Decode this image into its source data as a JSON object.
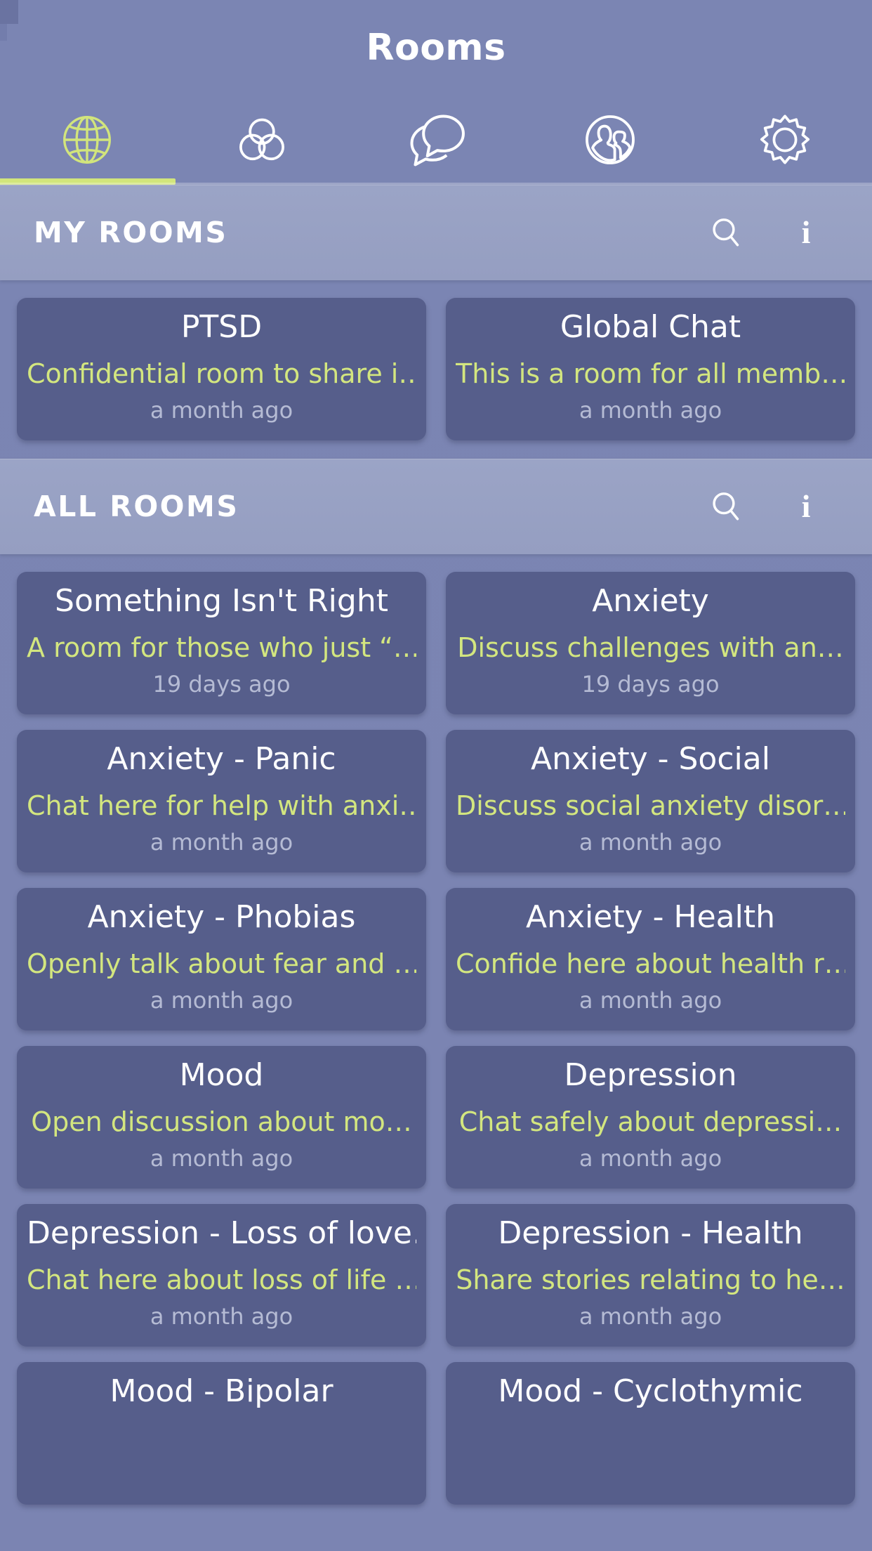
{
  "appbar": {
    "title": "Rooms"
  },
  "tabs": [
    {
      "label": "Global",
      "icon": "globe-icon",
      "active": true
    },
    {
      "label": "Groups",
      "icon": "circles-icon",
      "active": false
    },
    {
      "label": "Chat",
      "icon": "chat-bubbles-icon",
      "active": false
    },
    {
      "label": "Contacts",
      "icon": "people-circle-icon",
      "active": false
    },
    {
      "label": "Settings",
      "icon": "gear-icon",
      "active": false
    }
  ],
  "colors": {
    "background": "#7b85b3",
    "section_header": "#9ba4c6",
    "card": "#565e8b",
    "accent_green": "#d2e57c",
    "title_text": "#ffffff",
    "timestamp_text": "#b5bbd4"
  },
  "sections": [
    {
      "title": "MY ROOMS",
      "search_icon": "search-icon",
      "info_icon": "info-icon",
      "rooms": [
        {
          "title": "PTSD",
          "description": "Confidential room to share i…",
          "time": "a month ago"
        },
        {
          "title": "Global Chat",
          "description": "This is a room for all memb…",
          "time": "a month ago"
        }
      ]
    },
    {
      "title": "ALL ROOMS",
      "search_icon": "search-icon",
      "info_icon": "info-icon",
      "rooms": [
        {
          "title": "Something Isn't Right",
          "description": "A room for those who just “…",
          "time": "19 days ago"
        },
        {
          "title": "Anxiety",
          "description": "Discuss challenges with an…",
          "time": "19 days ago"
        },
        {
          "title": "Anxiety - Panic",
          "description": "Chat here for help with anxi…",
          "time": "a month ago"
        },
        {
          "title": "Anxiety - Social",
          "description": "Discuss social anxiety disor…",
          "time": "a month ago"
        },
        {
          "title": "Anxiety - Phobias",
          "description": "Openly talk about fear and …",
          "time": "a month ago"
        },
        {
          "title": "Anxiety - Health",
          "description": "Confide here about health r…",
          "time": "a month ago"
        },
        {
          "title": "Mood",
          "description": "Open discussion about mo…",
          "time": "a month ago"
        },
        {
          "title": "Depression",
          "description": "Chat safely about depressi…",
          "time": "a month ago"
        },
        {
          "title": "Depression - Loss of love…",
          "description": "Chat here about loss of life …",
          "time": "a month ago"
        },
        {
          "title": "Depression - Health",
          "description": "Share stories relating to he…",
          "time": "a month ago"
        },
        {
          "title": "Mood - Bipolar",
          "description": "",
          "time": ""
        },
        {
          "title": "Mood - Cyclothymic",
          "description": "",
          "time": ""
        }
      ]
    }
  ]
}
